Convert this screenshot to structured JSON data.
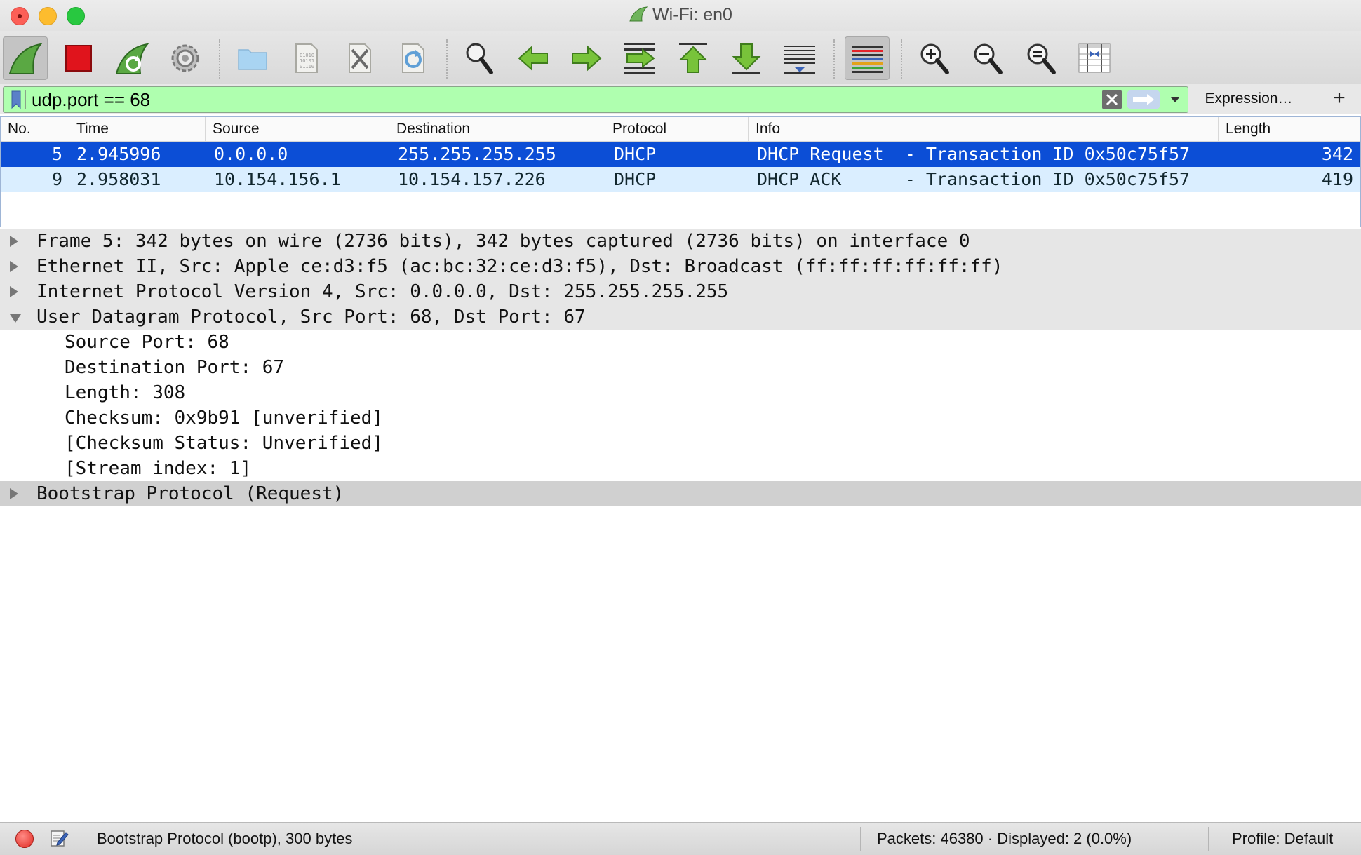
{
  "window": {
    "title": "Wi-Fi: en0"
  },
  "toolbar": {
    "buttons": [
      {
        "icon": "shark-fin-start-icon",
        "active": true
      },
      {
        "icon": "stop-capture-icon"
      },
      {
        "icon": "restart-capture-icon"
      },
      {
        "icon": "capture-options-gear-icon"
      },
      {
        "icon": "open-folder-icon"
      },
      {
        "icon": "save-file-icon"
      },
      {
        "icon": "close-file-icon"
      },
      {
        "icon": "reload-file-icon"
      },
      {
        "icon": "find-packet-icon"
      },
      {
        "icon": "go-back-icon"
      },
      {
        "icon": "go-forward-icon"
      },
      {
        "icon": "go-to-packet-icon"
      },
      {
        "icon": "first-packet-icon"
      },
      {
        "icon": "last-packet-icon"
      },
      {
        "icon": "auto-scroll-icon"
      },
      {
        "icon": "colorize-icon",
        "active": true
      },
      {
        "icon": "zoom-in-icon"
      },
      {
        "icon": "zoom-out-icon"
      },
      {
        "icon": "normal-size-icon"
      },
      {
        "icon": "resize-columns-icon"
      }
    ]
  },
  "filter": {
    "value": "udp.port == 68",
    "background": "#afffaf",
    "expression_label": "Expression…",
    "add_label": "+"
  },
  "packet_list": {
    "columns": [
      "No.",
      "Time",
      "Source",
      "Destination",
      "Protocol",
      "Info",
      "Length"
    ],
    "rows": [
      {
        "no": "5",
        "time": "2.945996",
        "source": "0.0.0.0",
        "destination": "255.255.255.255",
        "protocol": "DHCP",
        "info": "DHCP Request  - Transaction ID 0x50c75f57",
        "length": "342",
        "selected": true
      },
      {
        "no": "9",
        "time": "2.958031",
        "source": "10.154.156.1",
        "destination": "10.154.157.226",
        "protocol": "DHCP",
        "info": "DHCP ACK      - Transaction ID 0x50c75f57",
        "length": "419",
        "selected": false
      }
    ],
    "selected_color": "#0c4ed6",
    "row_color": "#daeeff"
  },
  "details": {
    "tree": [
      {
        "text": "Frame 5: 342 bytes on wire (2736 bits), 342 bytes captured (2736 bits) on interface 0",
        "expanded": false
      },
      {
        "text": "Ethernet II, Src: Apple_ce:d3:f5 (ac:bc:32:ce:d3:f5), Dst: Broadcast (ff:ff:ff:ff:ff:ff)",
        "expanded": false
      },
      {
        "text": "Internet Protocol Version 4, Src: 0.0.0.0, Dst: 255.255.255.255",
        "expanded": false
      },
      {
        "text": "User Datagram Protocol, Src Port: 68, Dst Port: 67",
        "expanded": true,
        "children": [
          "Source Port: 68",
          "Destination Port: 67",
          "Length: 308",
          "Checksum: 0x9b91 [unverified]",
          "[Checksum Status: Unverified]",
          "[Stream index: 1]"
        ]
      },
      {
        "text": "Bootstrap Protocol (Request)",
        "expanded": false
      }
    ]
  },
  "status": {
    "field_info": "Bootstrap Protocol (bootp), 300 bytes",
    "packets": "Packets: 46380 · Displayed: 2 (0.0%)",
    "profile": "Profile: Default"
  }
}
